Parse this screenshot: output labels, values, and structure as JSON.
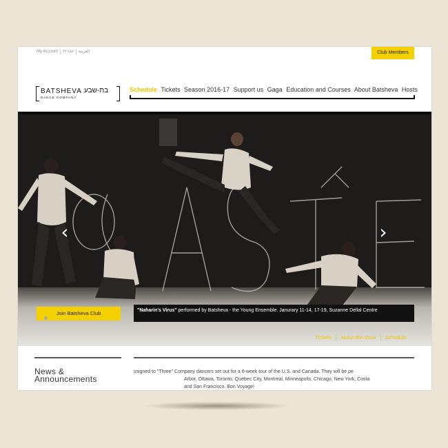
{
  "top_links": [
    "My Account",
    "עברית",
    "العربية"
  ],
  "club_button": "Club Members",
  "logo": {
    "name": "BATSHEVA",
    "hebrew": "בת-שבע",
    "subtitle": "DANCE COMPANY"
  },
  "nav": {
    "active": "Schedule",
    "items": [
      "Tickets",
      "Season 2016-17",
      "Support us",
      "Gaga",
      "Education and Courses",
      "About Batsheva",
      "Hosts"
    ]
  },
  "hero": {
    "join_button": "Join Batsheva Club",
    "caption_title": "\"Naharin's Virus\"",
    "caption_text": " performed by Batsheva - the Young Ensemble. Janurary 11-14, 17-19, Suzanne Dellal Centre",
    "subnav": [
      "Tickets",
      "About the show",
      "Schedule"
    ],
    "slides_total": 2,
    "slide_current": 1
  },
  "news": {
    "title_line1": "News &",
    "title_line2": "Announcements",
    "line1": "ssigned to \"Three\" Company dancers set out for a 6-week tour of the U.S. and Canada. They will be pe",
    "line2": "Arbor, Ottawa, Toronto, Quebec City, Montreal, Minneapolis, Chicago, New York, Costa",
    "line3": "and San Francisco. Bon Voyage!"
  },
  "colors": {
    "accent": "#f5d000",
    "background": "#ece5d6",
    "caption_bg": "#111111"
  }
}
